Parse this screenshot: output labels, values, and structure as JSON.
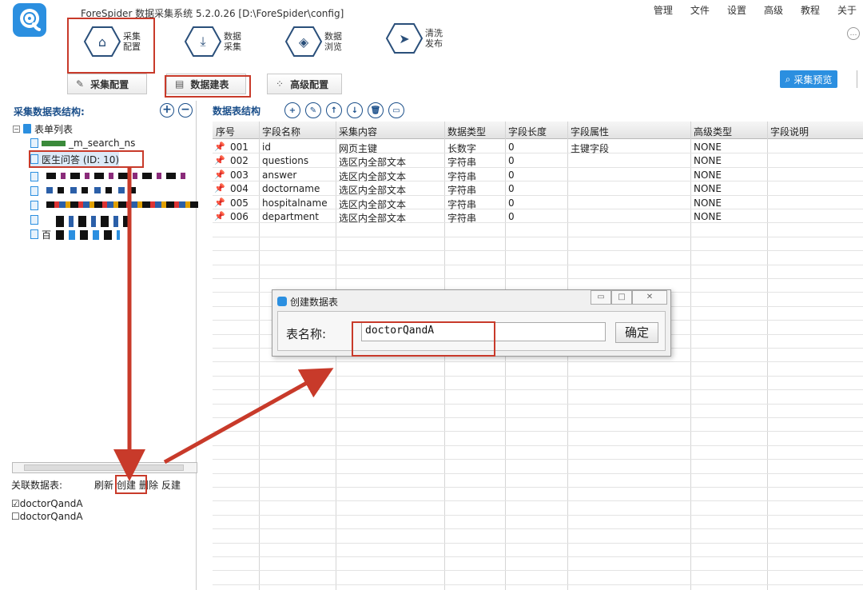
{
  "app": {
    "title": "ForeSpider 数据采集系统  5.2.0.26  [D:\\ForeSpider\\config]",
    "menu": [
      "管理",
      "文件",
      "设置",
      "高级",
      "教程",
      "关于"
    ]
  },
  "nav": {
    "items": [
      {
        "label1": "采集",
        "label2": "配置",
        "icon": "home-icon"
      },
      {
        "label1": "数据",
        "label2": "采集",
        "icon": "download-icon"
      },
      {
        "label1": "数据",
        "label2": "浏览",
        "icon": "layers-icon"
      },
      {
        "label1": "清洗",
        "label2": "发布",
        "icon": "send-icon"
      }
    ]
  },
  "subtoolbar": {
    "config": "采集配置",
    "tables": "数据建表",
    "advanced": "高级配置",
    "preview": "采集预览"
  },
  "left": {
    "header": "采集数据表结构:",
    "add": "+",
    "remove": "−",
    "root_label": "表单列表",
    "node1_label": "_m_search_ns",
    "selected_label": "医生问答 (ID: 10)",
    "last_label": "百",
    "assoc_label": "关联数据表:",
    "actions": [
      "刷新",
      "创建",
      "删除",
      "反建"
    ],
    "assoc_tables": [
      {
        "name": "doctorQandA",
        "checked": true
      },
      {
        "name": "doctorQandA",
        "checked": false
      }
    ]
  },
  "fields": {
    "header": "数据表结构",
    "tools": [
      "+",
      "✎",
      "↑",
      "↓",
      "🗑",
      "▭"
    ],
    "columns": [
      "序号",
      "字段名称",
      "采集内容",
      "数据类型",
      "字段长度",
      "字段属性",
      "高级类型",
      "字段说明"
    ],
    "rows": [
      [
        "001",
        "id",
        "网页主键",
        "长数字",
        "0",
        "主键字段",
        "NONE",
        ""
      ],
      [
        "002",
        "questions",
        "选区内全部文本",
        "字符串",
        "0",
        "",
        "NONE",
        ""
      ],
      [
        "003",
        "answer",
        "选区内全部文本",
        "字符串",
        "0",
        "",
        "NONE",
        ""
      ],
      [
        "004",
        "doctorname",
        "选区内全部文本",
        "字符串",
        "0",
        "",
        "NONE",
        ""
      ],
      [
        "005",
        "hospitalname",
        "选区内全部文本",
        "字符串",
        "0",
        "",
        "NONE",
        ""
      ],
      [
        "006",
        "department",
        "选区内全部文本",
        "字符串",
        "0",
        "",
        "NONE",
        ""
      ]
    ]
  },
  "dialog": {
    "title": "创建数据表",
    "label": "表名称:",
    "value": "doctorQandA",
    "ok": "确定"
  },
  "colors": {
    "accent": "#2b8fe0",
    "header_blue": "#1b4f8a",
    "annotation_red": "#c83a2a"
  }
}
